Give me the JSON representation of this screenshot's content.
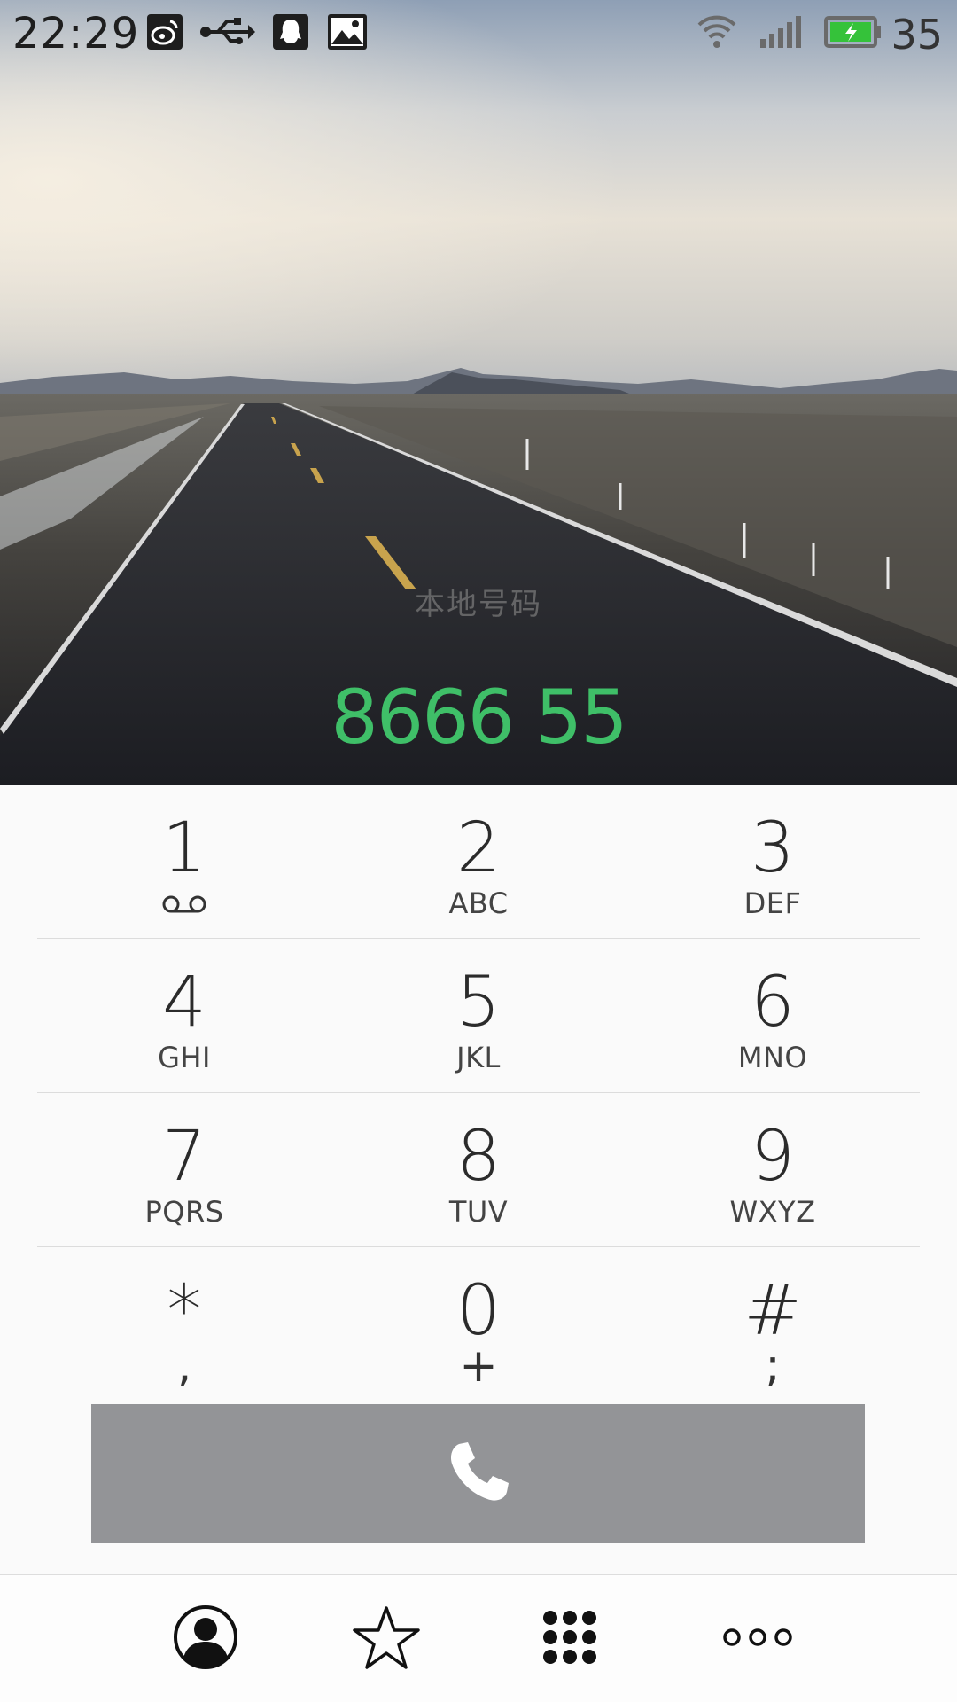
{
  "status_bar": {
    "time": "22:29",
    "icons": [
      "weibo-icon",
      "usb-icon",
      "qq-icon",
      "gallery-icon"
    ],
    "right_icons": [
      "wifi-icon",
      "signal-icon",
      "battery-charging-icon"
    ],
    "battery_percent": "35",
    "battery_color": "#35c23a"
  },
  "dialer": {
    "location_label": "本地号码",
    "number": "8666 55",
    "number_color": "#3fbf68"
  },
  "keypad": {
    "rows": [
      [
        {
          "digit": "1",
          "letters": "",
          "sub_icon": "voicemail-icon"
        },
        {
          "digit": "2",
          "letters": "ABC"
        },
        {
          "digit": "3",
          "letters": "DEF"
        }
      ],
      [
        {
          "digit": "4",
          "letters": "GHI"
        },
        {
          "digit": "5",
          "letters": "JKL"
        },
        {
          "digit": "6",
          "letters": "MNO"
        }
      ],
      [
        {
          "digit": "7",
          "letters": "PQRS"
        },
        {
          "digit": "8",
          "letters": "TUV"
        },
        {
          "digit": "9",
          "letters": "WXYZ"
        }
      ],
      [
        {
          "digit": "*",
          "letters": ","
        },
        {
          "digit": "0",
          "letters": "+"
        },
        {
          "digit": "#",
          "letters": ";"
        }
      ]
    ]
  },
  "call_button": {
    "icon": "phone-icon",
    "bg_color": "#939497"
  },
  "bottom_nav": {
    "items": [
      "contacts-icon",
      "favorites-star-icon",
      "dialpad-icon",
      "more-dots-icon"
    ]
  }
}
